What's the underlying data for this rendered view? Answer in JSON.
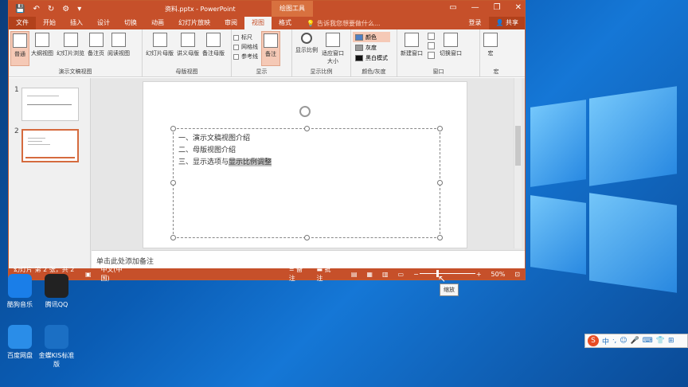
{
  "window": {
    "file_title": "资料.pptx - PowerPoint",
    "tool_tab": "绘图工具",
    "controls": [
      "▭",
      "—",
      "❐",
      "✕"
    ]
  },
  "tabs": [
    "文件",
    "开始",
    "插入",
    "设计",
    "切换",
    "动画",
    "幻灯片放映",
    "审阅",
    "视图",
    "格式"
  ],
  "active_tab": "视图",
  "tell_me": "告诉我您想要做什么...",
  "login": "登录",
  "share": "共享",
  "ribbon": {
    "presentation_views": {
      "label": "演示文稿视图",
      "buttons": [
        "普通",
        "大纲视图",
        "幻灯片浏览",
        "备注页",
        "阅读视图"
      ]
    },
    "master_views": {
      "label": "母版视图",
      "buttons": [
        "幻灯片母版",
        "讲义母版",
        "备注母版"
      ]
    },
    "show": {
      "label": "显示",
      "checks": [
        "标尺",
        "网格线",
        "参考线"
      ],
      "notes_button": "备注"
    },
    "zoom": {
      "label": "显示比例",
      "buttons": [
        "显示比例",
        "适应窗口大小"
      ]
    },
    "color": {
      "label": "颜色/灰度",
      "options": [
        "颜色",
        "灰度",
        "黑白模式"
      ]
    },
    "window": {
      "label": "窗口",
      "buttons": [
        "新建窗口",
        "切换窗口"
      ]
    },
    "macro": {
      "label": "宏",
      "buttons": [
        "宏"
      ]
    }
  },
  "slides": [
    {
      "number": "1"
    },
    {
      "number": "2"
    }
  ],
  "slide_lines": [
    "一、演示文稿视图介绍",
    "二、母版视图介绍",
    "三、显示选项与",
    "显示比例调整"
  ],
  "notes_placeholder": "单击此处添加备注",
  "status": {
    "slide_info": "幻灯片 第 2 张，共 2 张",
    "language": "中文(中国)",
    "notes": "备注",
    "comments": "批注",
    "zoom": "50%",
    "zoom_level": 0.5
  },
  "tooltip": "缩放",
  "desktop_icons": [
    {
      "label": "酷狗音乐",
      "color": "#1a7ee8"
    },
    {
      "label": "腾讯QQ",
      "color": "#222222"
    },
    {
      "label": "百度网盘",
      "color": "#2a8de8"
    },
    {
      "label": "金蝶KIS标准版",
      "color": "#1b6fc4"
    }
  ],
  "tray": {
    "ime": "中",
    "sogou": "S"
  }
}
